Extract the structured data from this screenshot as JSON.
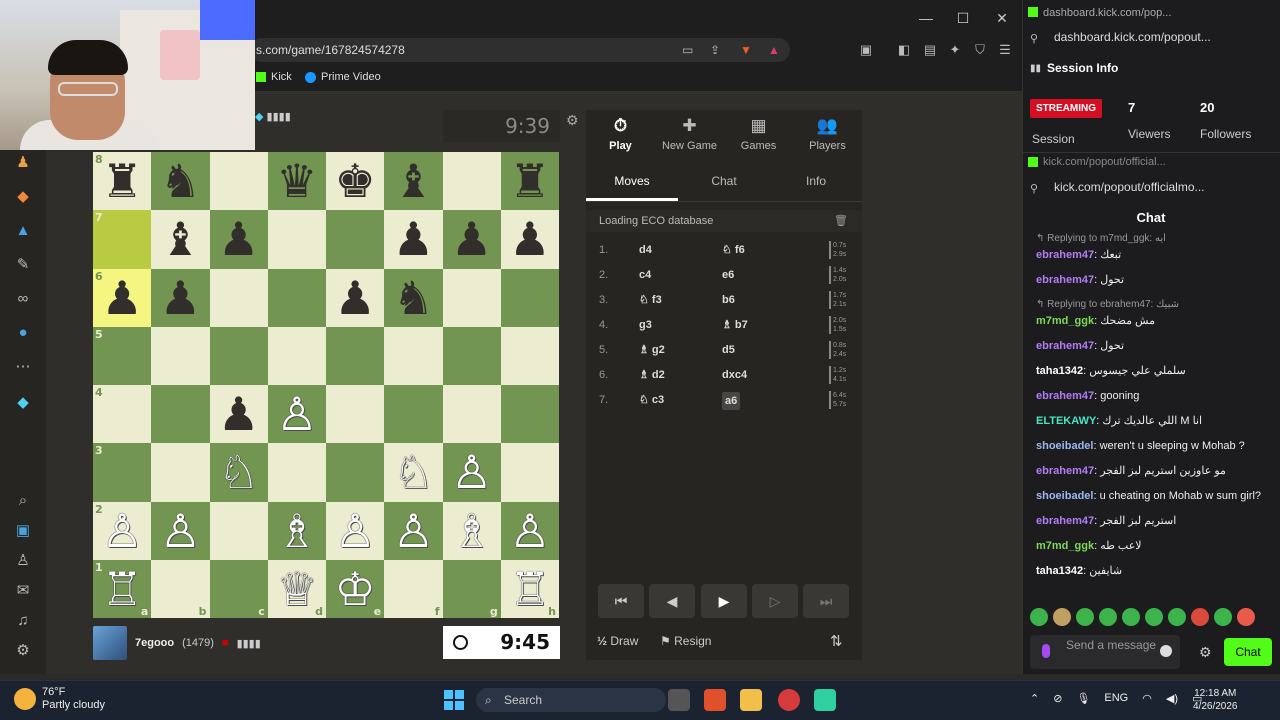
{
  "browser": {
    "url": "s.com/game/167824574278",
    "bookmarks": [
      "Kick",
      "Prime Video"
    ]
  },
  "opponent": {
    "signal": "▮▮▮▮",
    "clock": "9:39"
  },
  "board": {
    "ranks": [
      "8",
      "7",
      "6",
      "5",
      "4",
      "3",
      "2",
      "1"
    ],
    "files": [
      "a",
      "b",
      "c",
      "d",
      "e",
      "f",
      "g",
      "h"
    ],
    "squares": [
      [
        "♜",
        "♞",
        "",
        "♛",
        "♚",
        "♝",
        "",
        "♜"
      ],
      [
        "",
        "♝",
        "♟",
        "",
        "",
        "♟",
        "♟",
        "♟"
      ],
      [
        "♟",
        "♟",
        "",
        "",
        "♟",
        "♞",
        "",
        ""
      ],
      [
        "",
        "",
        "",
        "",
        "",
        "",
        "",
        ""
      ],
      [
        "",
        "",
        "♟",
        "♙",
        "",
        "",
        "",
        ""
      ],
      [
        "",
        "",
        "♘",
        "",
        "",
        "♘",
        "♙",
        ""
      ],
      [
        "♙",
        "♙",
        "",
        "♗",
        "♙",
        "♙",
        "♗",
        "♙"
      ],
      [
        "♖",
        "",
        "",
        "♕",
        "♔",
        "",
        "",
        "♖"
      ]
    ],
    "highlighted": [
      "a7",
      "a6"
    ]
  },
  "player": {
    "name": "7egooo",
    "rating": "(1479)",
    "signal": "▮▮▮▮",
    "clock": "9:45"
  },
  "panel": {
    "tabs": [
      {
        "label": "Play",
        "icon": "⏱"
      },
      {
        "label": "New Game",
        "icon": "✚"
      },
      {
        "label": "Games",
        "icon": "▦"
      },
      {
        "label": "Players",
        "icon": "👥"
      }
    ],
    "subtabs": [
      "Moves",
      "Chat",
      "Info"
    ],
    "eco": "Loading ECO database",
    "moves": [
      {
        "num": "1.",
        "white": "d4",
        "black": "♘ f6",
        "wt": "0.7s",
        "bt": "2.9s"
      },
      {
        "num": "2.",
        "white": "c4",
        "black": "e6",
        "wt": "1.4s",
        "bt": "2.0s"
      },
      {
        "num": "3.",
        "white": "♘ f3",
        "black": "b6",
        "wt": "1.7s",
        "bt": "2.1s"
      },
      {
        "num": "4.",
        "white": "g3",
        "black": "♗ b7",
        "wt": "2.0s",
        "bt": "1.5s"
      },
      {
        "num": "5.",
        "white": "♗ g2",
        "black": "d5",
        "wt": "0.8s",
        "bt": "2.4s"
      },
      {
        "num": "6.",
        "white": "♗ d2",
        "black": "dxc4",
        "wt": "1.2s",
        "bt": "4.1s"
      },
      {
        "num": "7.",
        "white": "♘ c3",
        "black": "a6",
        "wt": "6.4s",
        "bt": "5.7s"
      }
    ],
    "draw": "Draw",
    "resign": "Resign"
  },
  "kick_session": {
    "window_title": "dashboard.kick.com/pop...",
    "address": "dashboard.kick.com/popout...",
    "title": "Session Info",
    "badge": "STREAMING",
    "session_label": "Session",
    "viewers": "7",
    "viewers_label": "Viewers",
    "followers": "20",
    "followers_label": "Followers"
  },
  "kick_chat": {
    "window_title": "kick.com/popout/official...",
    "address": "kick.com/popout/officialmo...",
    "title": "Chat",
    "messages": [
      {
        "reply": "↰ Replying to m7md_ggk: ايه",
        "user": "ebrahem47",
        "color": "#b27cf5",
        "text": "تبعك"
      },
      {
        "reply": "",
        "user": "ebrahem47",
        "color": "#b27cf5",
        "text": "تحول"
      },
      {
        "reply": "↰ Replying to ebrahem47: شبيك",
        "user": "m7md_ggk",
        "color": "#7ed957",
        "text": "مش مضحك"
      },
      {
        "reply": "",
        "user": "ebrahem47",
        "color": "#b27cf5",
        "text": "تحول"
      },
      {
        "reply": "",
        "user": "taha1342",
        "color": "#ffffff",
        "text": "سلملي علي جيسوس"
      },
      {
        "reply": "",
        "user": "ebrahem47",
        "color": "#b27cf5",
        "text": "gooning"
      },
      {
        "reply": "",
        "user": "ELTEKAWY",
        "color": "#47e5c2",
        "text": "اللي عالديك ترك M انا"
      },
      {
        "reply": "",
        "user": "shoeibadel",
        "color": "#9ab8f0",
        "text": "weren't u sleeping w Mohab ?"
      },
      {
        "reply": "",
        "user": "ebrahem47",
        "color": "#b27cf5",
        "text": "مو عاوزين استريم لبز الفجر"
      },
      {
        "reply": "",
        "user": "shoeibadel",
        "color": "#9ab8f0",
        "text": "u cheating on Mohab w sum girl?"
      },
      {
        "reply": "",
        "user": "ebrahem47",
        "color": "#b27cf5",
        "text": "استريم لبز الفجر"
      },
      {
        "reply": "",
        "user": "m7md_ggk",
        "color": "#7ed957",
        "text": "لاعب طه"
      },
      {
        "reply": "",
        "user": "taha1342",
        "color": "#ffffff",
        "text": "شايفين"
      }
    ],
    "input_placeholder": "Send a message",
    "send": "Chat"
  },
  "taskbar": {
    "temp": "76°F",
    "weather": "Partly cloudy",
    "search": "Search",
    "lang": "ENG",
    "time": "12:18 AM",
    "date": "4/26/2026"
  }
}
